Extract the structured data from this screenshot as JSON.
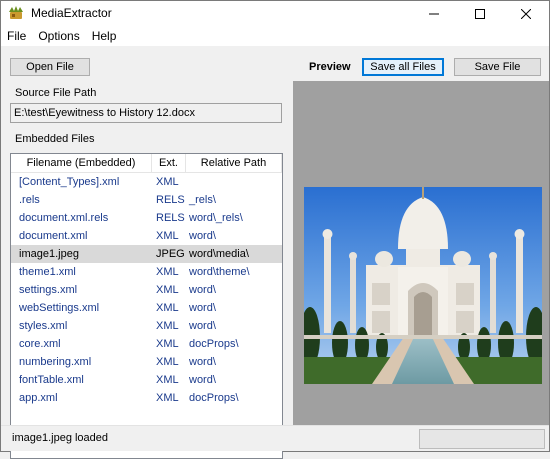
{
  "window": {
    "title": "MediaExtractor"
  },
  "menu": {
    "items": [
      "File",
      "Options",
      "Help"
    ]
  },
  "left": {
    "open_button": "Open File",
    "source_label": "Source File Path",
    "source_path": "E:\\test\\Eyewitness to History 12.docx",
    "embedded_label": "Embedded Files",
    "columns": [
      "Filename (Embedded)",
      "Ext.",
      "Relative Path"
    ],
    "rows": [
      {
        "name": "[Content_Types].xml",
        "ext": "XML",
        "path": ""
      },
      {
        "name": ".rels",
        "ext": "RELS",
        "path": "_rels\\"
      },
      {
        "name": "document.xml.rels",
        "ext": "RELS",
        "path": "word\\_rels\\"
      },
      {
        "name": "document.xml",
        "ext": "XML",
        "path": "word\\"
      },
      {
        "name": "image1.jpeg",
        "ext": "JPEG",
        "path": "word\\media\\",
        "selected": true
      },
      {
        "name": "theme1.xml",
        "ext": "XML",
        "path": "word\\theme\\"
      },
      {
        "name": "settings.xml",
        "ext": "XML",
        "path": "word\\"
      },
      {
        "name": "webSettings.xml",
        "ext": "XML",
        "path": "word\\"
      },
      {
        "name": "styles.xml",
        "ext": "XML",
        "path": "word\\"
      },
      {
        "name": "core.xml",
        "ext": "XML",
        "path": "docProps\\"
      },
      {
        "name": "numbering.xml",
        "ext": "XML",
        "path": "word\\"
      },
      {
        "name": "fontTable.xml",
        "ext": "XML",
        "path": "word\\"
      },
      {
        "name": "app.xml",
        "ext": "XML",
        "path": "docProps\\"
      }
    ]
  },
  "right": {
    "preview_label": "Preview",
    "save_all_button": "Save all Files",
    "save_file_button": "Save File",
    "preview_image": "taj-mahal-photo"
  },
  "status": {
    "text": "image1.jpeg loaded",
    "progress": 0
  },
  "colors": {
    "link_text": "#1a3a8c",
    "selected_row": "#d9d9d9",
    "preview_bg": "#a0a0a0",
    "focus_border": "#0078d7"
  }
}
